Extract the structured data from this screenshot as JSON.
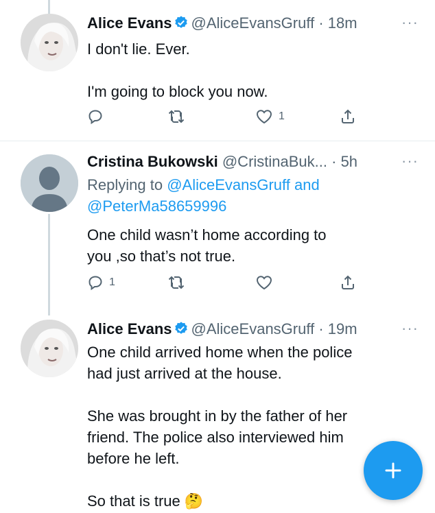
{
  "tweets": [
    {
      "name": "Alice Evans",
      "handle": "@AliceEvansGruff",
      "time": "· 18m",
      "more": "···",
      "text": "I don't lie. Ever.\n\nI'm going to block you now.",
      "replies": "",
      "retweets": "",
      "likes": "1"
    },
    {
      "name": "Cristina Bukowski",
      "handle": "@CristinaBuk...",
      "time": "· 5h",
      "more": "···",
      "replying_prefix": "Replying to",
      "replying_user1": "@AliceEvansGruff",
      "replying_and": "and",
      "replying_user2": "@PeterMa58659996",
      "text": "One child wasn’t home according to\nyou ,so that’s not true.",
      "replies": "1",
      "retweets": "",
      "likes": ""
    },
    {
      "name": "Alice Evans",
      "handle": "@AliceEvansGruff",
      "time": "· 19m",
      "more": "···",
      "text": "One child arrived home when the police\nhad just arrived at the house.\n\nShe was brought in by the father of her\nfriend. The police also interviewed him\nbefore he left.\n\nSo that is true 🤔"
    }
  ],
  "icons": {
    "verified": "verified-badge-icon",
    "reply": "reply-icon",
    "retweet": "retweet-icon",
    "like": "heart-icon",
    "share": "share-icon",
    "compose": "compose-plus-icon"
  },
  "colors": {
    "accent": "#1d9bf0",
    "secondary_text": "#536471",
    "divider": "#e6ecf0"
  }
}
